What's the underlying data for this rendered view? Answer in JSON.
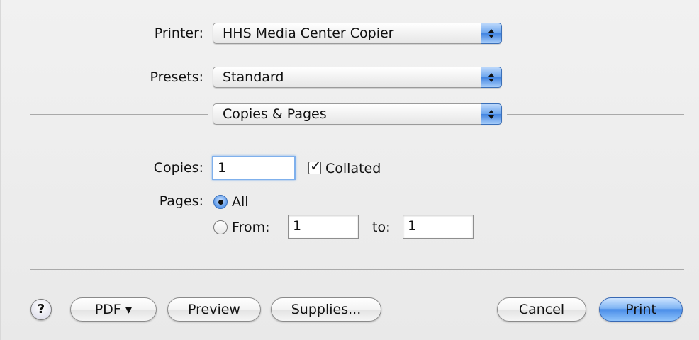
{
  "printer": {
    "label": "Printer:",
    "value": "HHS Media Center Copier"
  },
  "presets": {
    "label": "Presets:",
    "value": "Standard"
  },
  "section": {
    "value": "Copies & Pages"
  },
  "copies": {
    "label": "Copies:",
    "value": "1",
    "collated_label": "Collated",
    "collated_checked": true
  },
  "pages": {
    "label": "Pages:",
    "all_label": "All",
    "from_label": "From:",
    "from_value": "1",
    "to_label": "to:",
    "to_value": "1",
    "selected": "All"
  },
  "buttons": {
    "help": "?",
    "pdf": "PDF ▾",
    "preview": "Preview",
    "supplies": "Supplies...",
    "cancel": "Cancel",
    "print": "Print"
  },
  "colors": {
    "accent": "#4a8de8",
    "background": "#ededed"
  }
}
